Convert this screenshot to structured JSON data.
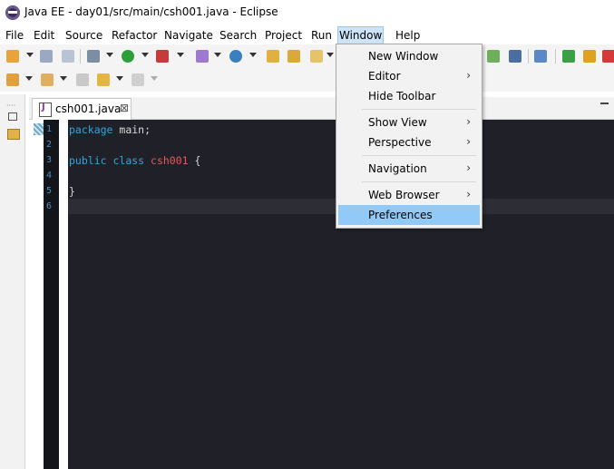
{
  "window": {
    "title": "Java EE - day01/src/main/csh001.java - Eclipse"
  },
  "menubar": {
    "items": [
      "File",
      "Edit",
      "Source",
      "Refactor",
      "Navigate",
      "Search",
      "Project",
      "Run",
      "Window",
      "Help"
    ],
    "active": "Window"
  },
  "editor": {
    "tab_label": "csh001.java",
    "tab_close": "⊠",
    "line_numbers": [
      "1",
      "2",
      "3",
      "4",
      "5",
      "6"
    ],
    "code": {
      "l1_kw": "package",
      "l1_rest": " main;",
      "l3_kw1": "public",
      "l3_kw2": " class",
      "l3_cls": " csh001",
      "l3_rest": " {",
      "l5": "}"
    }
  },
  "window_menu": {
    "items": [
      {
        "label": "New Window",
        "submenu": false
      },
      {
        "label": "Editor",
        "submenu": true
      },
      {
        "label": "Hide Toolbar",
        "submenu": false
      },
      {
        "label": "Show View",
        "submenu": true
      },
      {
        "label": "Perspective",
        "submenu": true
      },
      {
        "label": "Navigation",
        "submenu": true
      },
      {
        "label": "Web Browser",
        "submenu": true
      },
      {
        "label": "Preferences",
        "submenu": false,
        "highlighted": true
      }
    ],
    "submenu_arrow": "›"
  },
  "colors": {
    "editor_bg": "#1f2028",
    "keyword": "#2fa7e0",
    "class_name": "#e05a5a",
    "menu_highlight": "#91c9f7"
  }
}
